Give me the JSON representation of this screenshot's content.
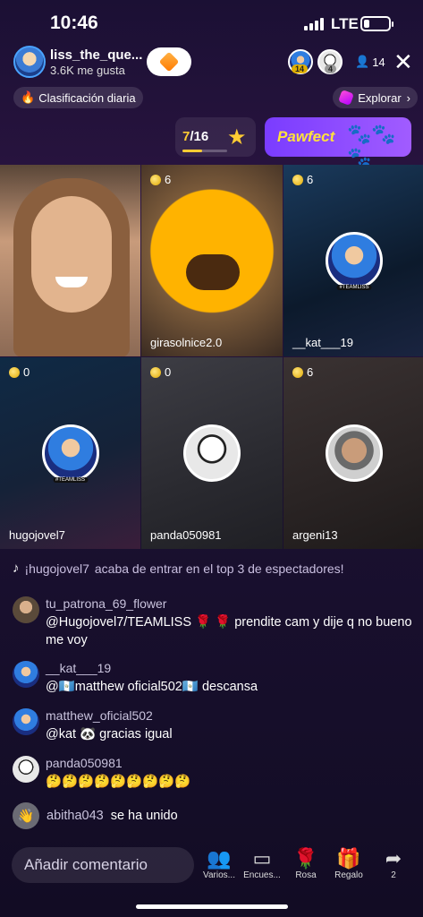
{
  "status_bar": {
    "time": "10:46",
    "network": "LTE"
  },
  "header": {
    "host_name": "liss_the_que...",
    "host_likes": "3.6K me gusta",
    "viewer_badges": [
      "14",
      "4"
    ],
    "viewer_count": "14"
  },
  "ranking": {
    "label": "Clasificación diaria"
  },
  "explore": {
    "label": "Explorar"
  },
  "progress": {
    "current": "7",
    "total": "/16",
    "fraction": 0.44
  },
  "promo": {
    "label": "Pawfect"
  },
  "tiles": [
    {
      "name": "",
      "coins": ""
    },
    {
      "name": "girasolnice2.0",
      "coins": "6"
    },
    {
      "name": "__kat___19",
      "coins": "6"
    },
    {
      "name": "hugojovel7",
      "coins": "0"
    },
    {
      "name": "panda050981",
      "coins": "0"
    },
    {
      "name": "argeni13",
      "coins": "6"
    }
  ],
  "chat": {
    "system": {
      "user": "¡hugojovel7",
      "text": "acaba de entrar en el top 3 de espectadores!"
    },
    "messages": [
      {
        "user": "tu_patrona_69_flower",
        "text": "@Hugojovel7/TEAMLISS 🌹 🌹 prendite cam y dije q no bueno me voy"
      },
      {
        "user": "__kat___19",
        "text": "@🇬🇹matthew oficial502🇬🇹 descansa"
      },
      {
        "user": "matthew_oficial502",
        "text": "@kat 🐼 gracias igual"
      },
      {
        "user": "panda050981",
        "text": "🤔🤔🤔🤔🤔🤔🤔🤔🤔"
      }
    ],
    "join": {
      "user": "abitha043",
      "text": "se ha unido"
    }
  },
  "bottom": {
    "comment_placeholder": "Añadir comentario",
    "actions": [
      "Varios...",
      "Encues...",
      "Rosa",
      "Regalo",
      "2"
    ]
  },
  "colors": {
    "accent": "#ffcc33",
    "promo": "#8a4bff",
    "background": "#1b1034"
  }
}
